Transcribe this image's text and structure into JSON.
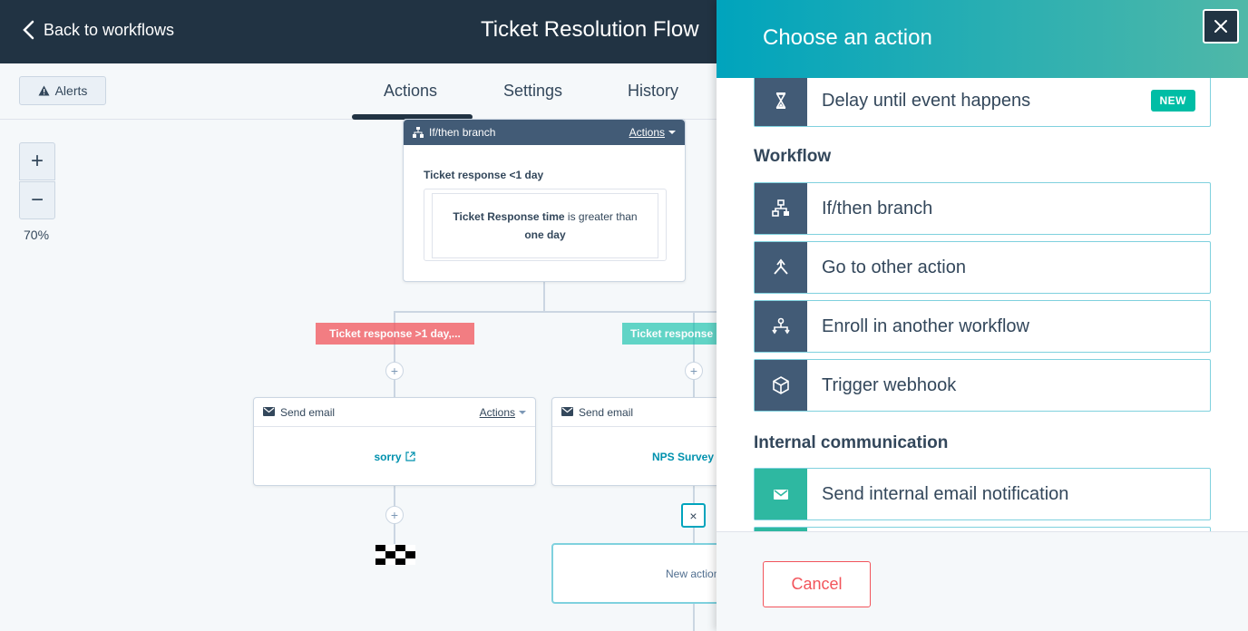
{
  "topbar": {
    "back_label": "Back to workflows",
    "title": "Ticket Resolution Flow"
  },
  "subnav": {
    "alerts_label": "Alerts",
    "tabs": [
      {
        "label": "Actions",
        "active": true
      },
      {
        "label": "Settings",
        "active": false
      },
      {
        "label": "History",
        "active": false
      }
    ]
  },
  "zoom": {
    "plus": "+",
    "minus": "−",
    "level": "70%"
  },
  "canvas": {
    "branch_card": {
      "type_label": "If/then branch",
      "actions_label": "Actions",
      "condition_title": "Ticket response <1 day",
      "condition_field": "Ticket Response time",
      "condition_op": " is greater than",
      "condition_value": "one day"
    },
    "branch_labels": {
      "left": "Ticket response >1 day,...",
      "right": "Ticket response"
    },
    "email_card_1": {
      "type_label": "Send email",
      "actions_label": "Actions",
      "email_name": "sorry"
    },
    "email_card_2": {
      "type_label": "Send email",
      "email_name": "NPS Survey"
    },
    "plus": "+",
    "close_x": "×",
    "new_action_label": "New action"
  },
  "panel": {
    "title": "Choose an action",
    "top_option": {
      "label": "Delay until event happens",
      "badge": "NEW",
      "icon": "hourglass-icon"
    },
    "sections": [
      {
        "title": "Workflow",
        "options": [
          {
            "label": "If/then branch",
            "icon": "branch-icon"
          },
          {
            "label": "Go to other action",
            "icon": "merge-arrow-icon"
          },
          {
            "label": "Enroll in another workflow",
            "icon": "enroll-workflow-icon"
          },
          {
            "label": "Trigger webhook",
            "icon": "cube-icon"
          }
        ]
      },
      {
        "title": "Internal communication",
        "options": [
          {
            "label": "Send internal email notification",
            "icon": "envelope-icon"
          }
        ]
      }
    ],
    "cancel_label": "Cancel"
  },
  "colors": {
    "topbar": "#213343",
    "accent_teal": "#00a4bd",
    "badge_green": "#00bda5",
    "danger": "#f2545b",
    "icon_dark": "#425b76"
  }
}
